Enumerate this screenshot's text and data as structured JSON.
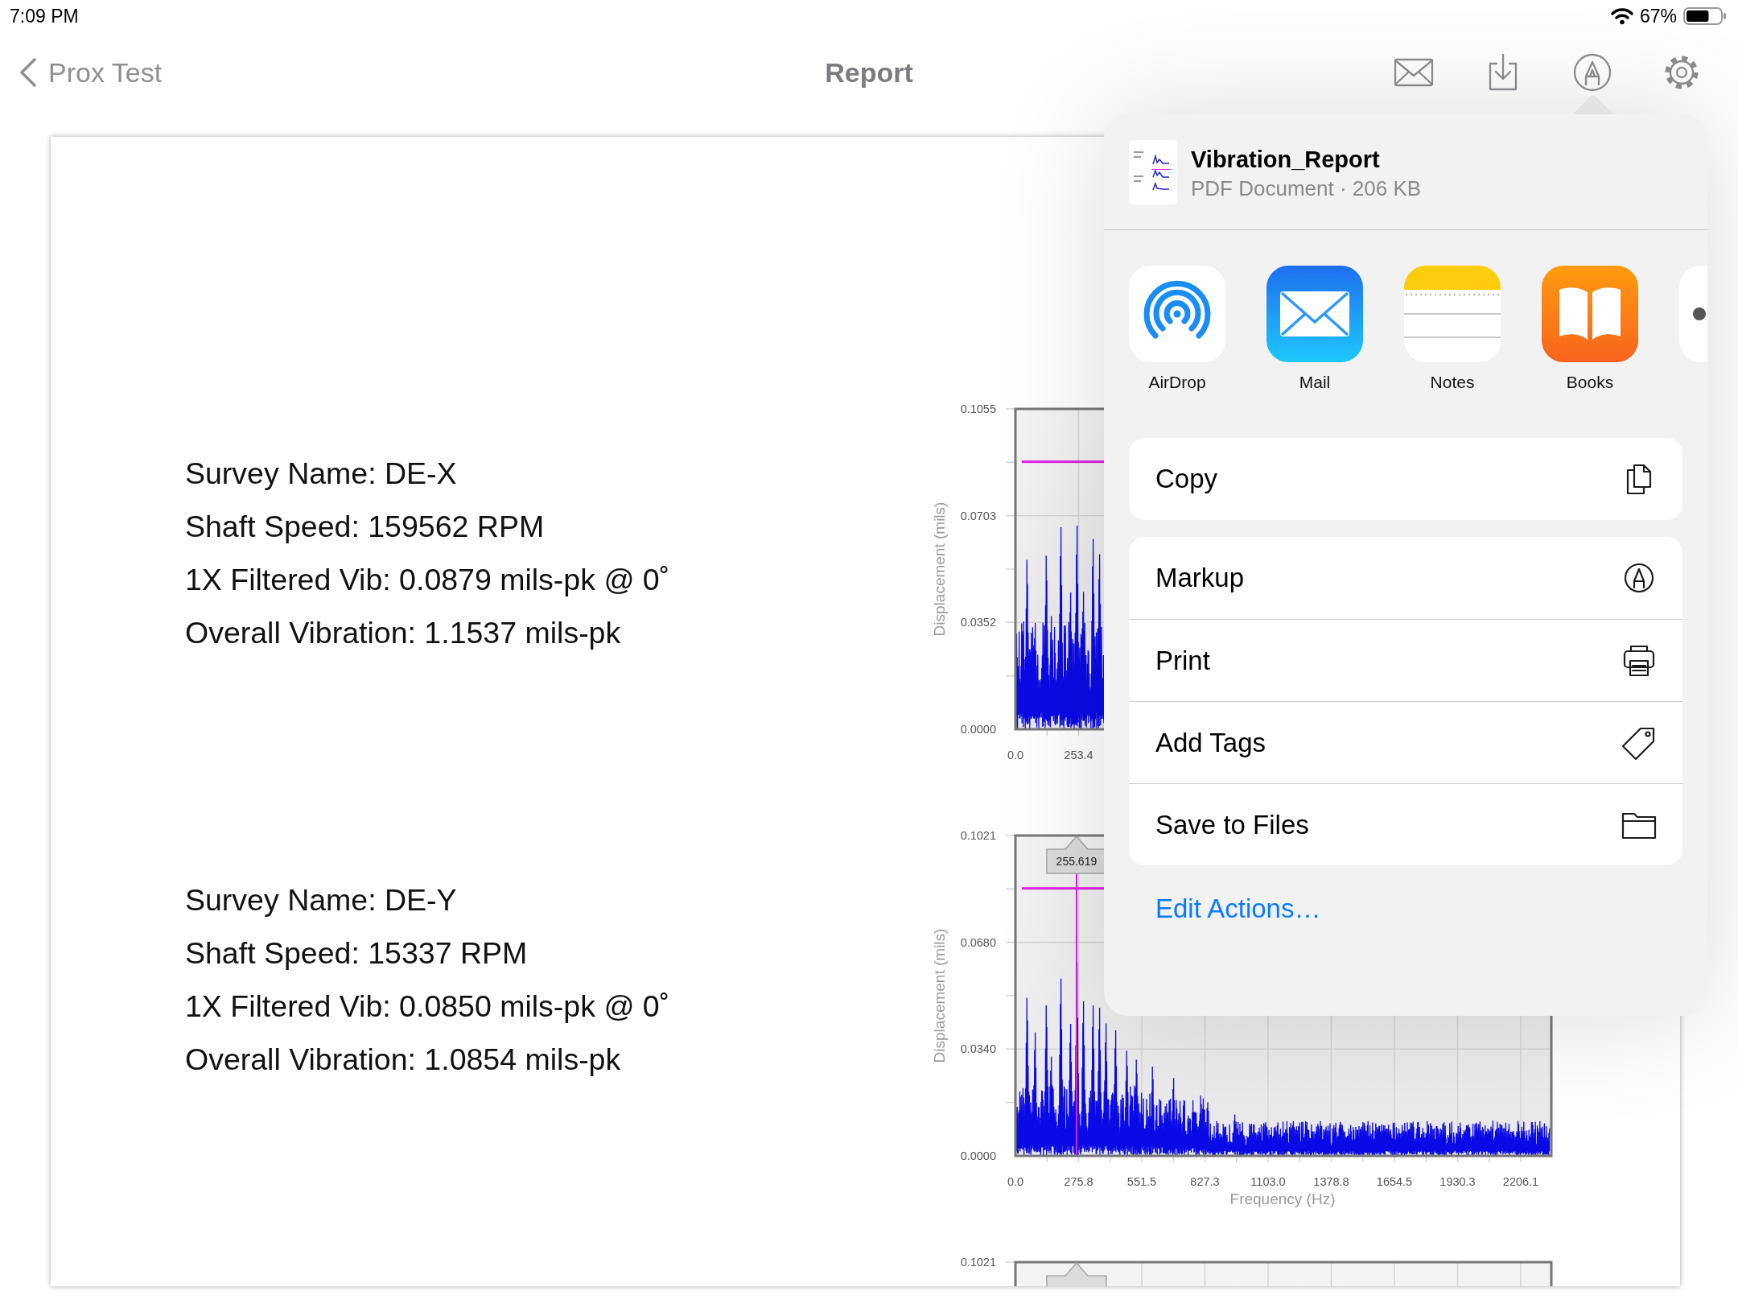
{
  "status_bar": {
    "time": "7:09 PM",
    "battery": "67%"
  },
  "nav_bar": {
    "back": "Prox Test",
    "title": "Report"
  },
  "report": {
    "sections": [
      {
        "lines": [
          "Survey Name: DE-X",
          "Shaft Speed: 159562 RPM",
          "1X Filtered Vib: 0.0879 mils-pk @ 0˚",
          "Overall Vibration: 1.1537 mils-pk"
        ],
        "chart": {
          "y_title": "Displacement (mils)",
          "yticks": [
            "0.1055",
            "0.0703",
            "0.0352",
            "0.0000"
          ],
          "xticks": [
            "0.0",
            "253.4"
          ],
          "trace": true,
          "reference_line": true
        }
      },
      {
        "lines": [
          "Survey Name: DE-Y",
          "Shaft Speed: 15337 RPM",
          "1X Filtered Vib: 0.0850 mils-pk @ 0˚",
          "Overall Vibration: 1.0854 mils-pk"
        ],
        "chart": {
          "y_title": "Displacement (mils)",
          "yticks": [
            "0.1021",
            "0.0680",
            "0.0340",
            "0.0000"
          ],
          "xticks": [
            "0.0",
            "275.8",
            "551.5",
            "827.3",
            "1103.0",
            "1378.8",
            "1654.5",
            "1930.3",
            "2206.1"
          ],
          "x_title": "Frequency (Hz)",
          "trace": true,
          "reference_line": true,
          "cursor": {
            "label": "255.619",
            "level": 0.114
          }
        }
      },
      {
        "chart": {
          "yticks": [
            "0.1021"
          ],
          "cursor": {
            "level": 0.114
          }
        }
      }
    ]
  },
  "share_sheet": {
    "file_name": "Vibration_Report",
    "file_info": "PDF Document · 206 KB",
    "apps": [
      {
        "label": "AirDrop",
        "kind": "airdrop"
      },
      {
        "label": "Mail",
        "kind": "mail"
      },
      {
        "label": "Notes",
        "kind": "notes"
      },
      {
        "label": "Books",
        "kind": "books"
      },
      {
        "kind": "more"
      }
    ],
    "action_groups": [
      [
        {
          "label": "Copy",
          "kind": "copy"
        }
      ],
      [
        {
          "label": "Markup",
          "kind": "markup"
        },
        {
          "label": "Print",
          "kind": "print"
        },
        {
          "label": "Add Tags",
          "kind": "tags"
        },
        {
          "label": "Save to Files",
          "kind": "files"
        }
      ]
    ],
    "edit_actions": "Edit Actions…"
  }
}
